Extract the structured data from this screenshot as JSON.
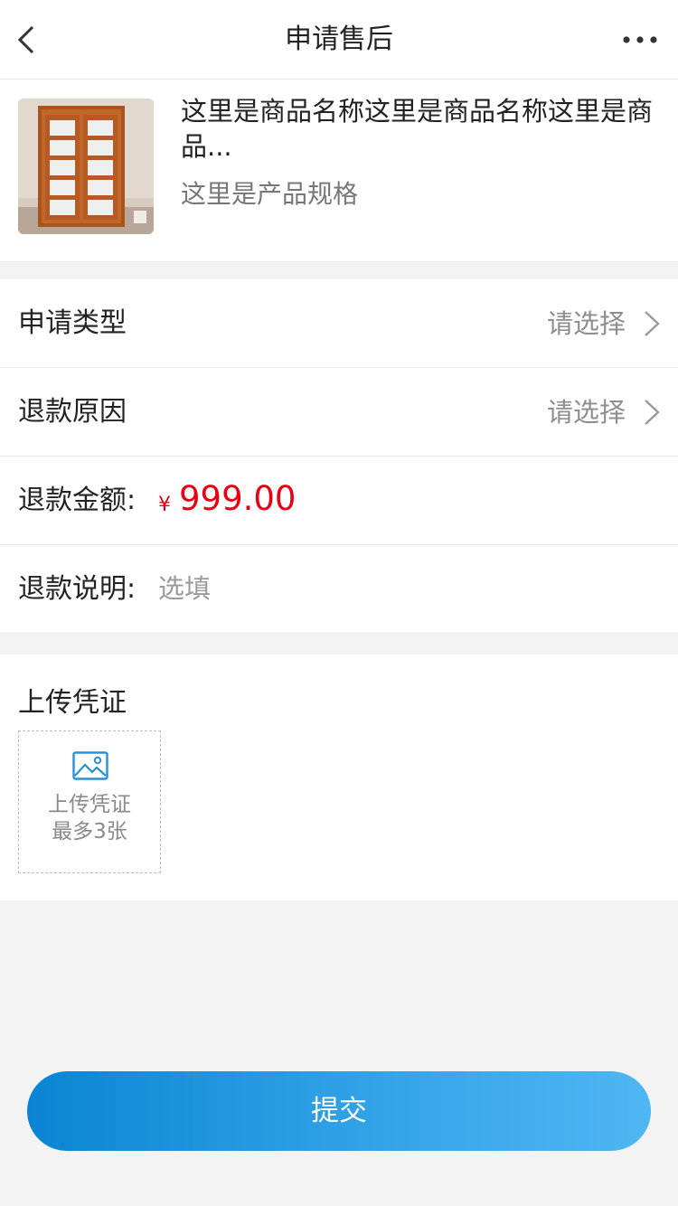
{
  "header": {
    "title": "申请售后",
    "back_icon": "chevron-left-icon",
    "more_icon": "more-dots-icon"
  },
  "product": {
    "name": "这里是商品名称这里是商品名称这里是商品...",
    "spec": "这里是产品规格"
  },
  "form": {
    "apply_type": {
      "label": "申请类型",
      "value": "请选择"
    },
    "refund_reason": {
      "label": "退款原因",
      "value": "请选择"
    },
    "refund_amount": {
      "label": "退款金额:",
      "currency": "¥",
      "amount": "999.00"
    },
    "refund_note": {
      "label": "退款说明:",
      "placeholder": "选填"
    }
  },
  "upload": {
    "heading": "上传凭证",
    "box_line1": "上传凭证",
    "box_line2": "最多3张"
  },
  "submit_label": "提交",
  "colors": {
    "price": "#e60012",
    "button_start": "#0a85d3",
    "button_end": "#4fb7f2"
  }
}
